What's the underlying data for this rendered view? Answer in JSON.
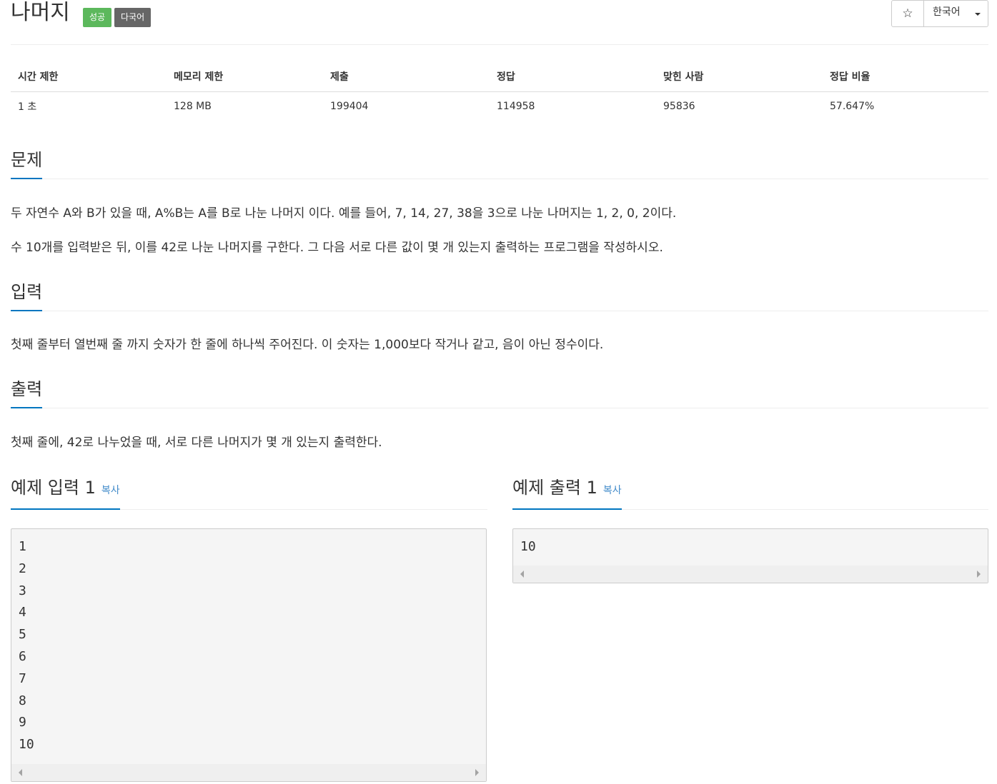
{
  "problem": {
    "title": "나머지",
    "badges": {
      "success": "성공",
      "multilang": "다국어"
    },
    "star_icon": "☆",
    "language": "한국어"
  },
  "info_table": {
    "headers": [
      "시간 제한",
      "메모리 제한",
      "제출",
      "정답",
      "맞힌 사람",
      "정답 비율"
    ],
    "values": [
      "1 초",
      "128 MB",
      "199404",
      "114958",
      "95836",
      "57.647%"
    ]
  },
  "sections": {
    "description": {
      "heading": "문제",
      "paragraphs": [
        "두 자연수 A와 B가 있을 때, A%B는 A를 B로 나눈 나머지 이다. 예를 들어, 7, 14, 27, 38을 3으로 나눈 나머지는 1, 2, 0, 2이다.",
        "수 10개를 입력받은 뒤, 이를 42로 나눈 나머지를 구한다. 그 다음 서로 다른 값이 몇 개 있는지 출력하는 프로그램을 작성하시오."
      ]
    },
    "input": {
      "heading": "입력",
      "text": "첫째 줄부터 열번째 줄 까지 숫자가 한 줄에 하나씩 주어진다. 이 숫자는 1,000보다 작거나 같고, 음이 아닌 정수이다."
    },
    "output": {
      "heading": "출력",
      "text": "첫째 줄에, 42로 나누었을 때, 서로 다른 나머지가 몇 개 있는지 출력한다."
    }
  },
  "samples": {
    "input": {
      "heading": "예제 입력 1",
      "copy_label": "복사",
      "lines": [
        "1",
        "2",
        "3",
        "4",
        "5",
        "6",
        "7",
        "8",
        "9",
        "10"
      ]
    },
    "output": {
      "heading": "예제 출력 1",
      "copy_label": "복사",
      "lines": [
        "10"
      ]
    }
  },
  "colors": {
    "accent": "#0076c0",
    "link": "#428bca",
    "success": "#5cb85c",
    "multilang": "#666666"
  }
}
